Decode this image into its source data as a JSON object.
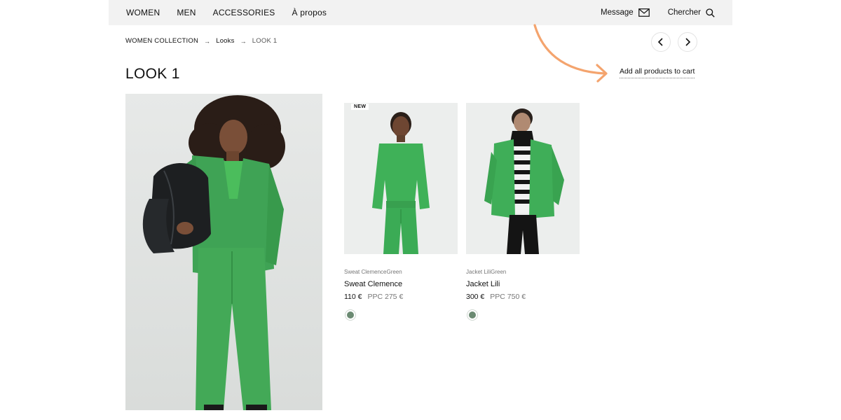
{
  "nav": {
    "items": [
      "WOMEN",
      "MEN",
      "ACCESSORIES",
      "À propos"
    ],
    "message_label": "Message",
    "search_label": "Chercher"
  },
  "breadcrumb": {
    "items": [
      "WOMEN COLLECTION",
      "Looks",
      "LOOK 1"
    ],
    "separator": "→"
  },
  "page": {
    "title": "LOOK 1",
    "add_all_label": "Add all products to cart"
  },
  "colors": {
    "accent_arrow": "#f4a46e",
    "product_green": "#3fa355",
    "swatch_green": "#6b8a72"
  },
  "products": [
    {
      "badge": "NEW",
      "subtitle": "Sweat ClemenceGreen",
      "name": "Sweat Clemence",
      "price": "110 €",
      "ppc": "PPC 275 €"
    },
    {
      "badge": "",
      "subtitle": "Jacket LiliGreen",
      "name": "Jacket Lili",
      "price": "300 €",
      "ppc": "PPC 750 €"
    }
  ]
}
